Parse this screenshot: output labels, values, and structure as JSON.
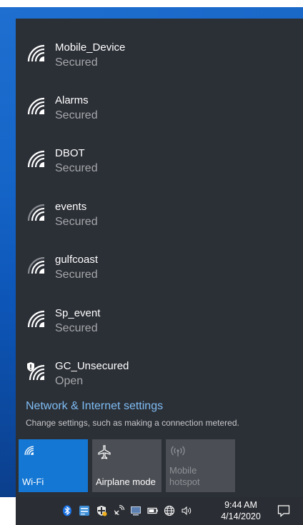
{
  "networks": [
    {
      "name": "Mobile_Device",
      "status": "Secured",
      "strength": "strong",
      "icon": "wifi-icon"
    },
    {
      "name": "Alarms",
      "status": "Secured",
      "strength": "strong",
      "icon": "wifi-icon"
    },
    {
      "name": "DBOT",
      "status": "Secured",
      "strength": "strong",
      "icon": "wifi-icon"
    },
    {
      "name": "events",
      "status": "Secured",
      "strength": "weak",
      "icon": "wifi-icon"
    },
    {
      "name": "gulfcoast",
      "status": "Secured",
      "strength": "weak",
      "icon": "wifi-icon"
    },
    {
      "name": "Sp_event",
      "status": "Secured",
      "strength": "strong",
      "icon": "wifi-icon"
    },
    {
      "name": "GC_Unsecured",
      "status": "Open",
      "strength": "strong",
      "icon": "wifi-shield-icon"
    }
  ],
  "settings": {
    "link_label": "Network & Internet settings",
    "description": "Change settings, such as making a connection metered."
  },
  "quick_actions": {
    "wifi": {
      "label": "Wi-Fi",
      "active": true,
      "icon": "wifi-icon"
    },
    "airplane": {
      "label": "Airplane mode",
      "active": false,
      "icon": "airplane-icon"
    },
    "hotspot_line1": "Mobile",
    "hotspot_line2": "hotspot",
    "hotspot_enabled": false,
    "hotspot_icon": "hotspot-icon"
  },
  "taskbar": {
    "time": "9:44 AM",
    "date": "4/14/2020",
    "tray_icons": [
      "bluetooth-icon",
      "app-icon",
      "security-icon",
      "satellite-icon",
      "display-icon",
      "battery-icon",
      "network-globe-icon",
      "volume-icon"
    ],
    "notification_icon": "notification-icon"
  },
  "colors": {
    "panel": "#2b2f36",
    "accent": "#1477d4",
    "link": "#7fbdf4",
    "tile_inactive": "#4b4e54"
  }
}
